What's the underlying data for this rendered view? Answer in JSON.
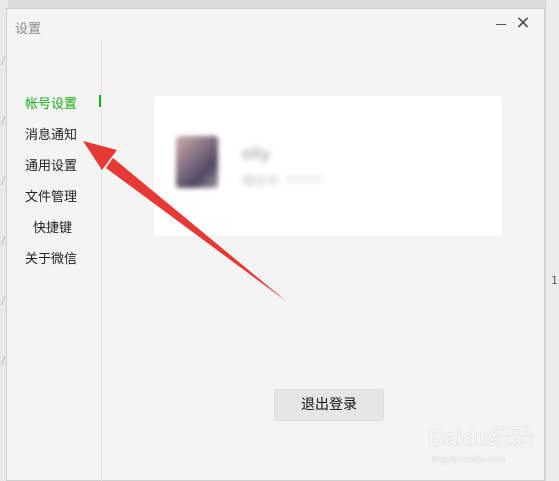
{
  "window": {
    "title": "设置"
  },
  "sidebar": {
    "items": [
      {
        "label": "帐号设置",
        "active": true
      },
      {
        "label": "消息通知",
        "active": false
      },
      {
        "label": "通用设置",
        "active": false
      },
      {
        "label": "文件管理",
        "active": false
      },
      {
        "label": "快捷键",
        "active": false
      },
      {
        "label": "关于微信",
        "active": false
      }
    ]
  },
  "account": {
    "nickname": "olly",
    "subtitle": "微信号: ******"
  },
  "actions": {
    "logout_label": "退出登录"
  },
  "watermark": {
    "brand": "Baidu经验",
    "sub": "jingyan.baidu.com"
  },
  "colors": {
    "accent": "#1aad19",
    "annotation": "#e53935"
  },
  "icons": {
    "close": "close-icon",
    "minimize": "minimize-icon"
  }
}
